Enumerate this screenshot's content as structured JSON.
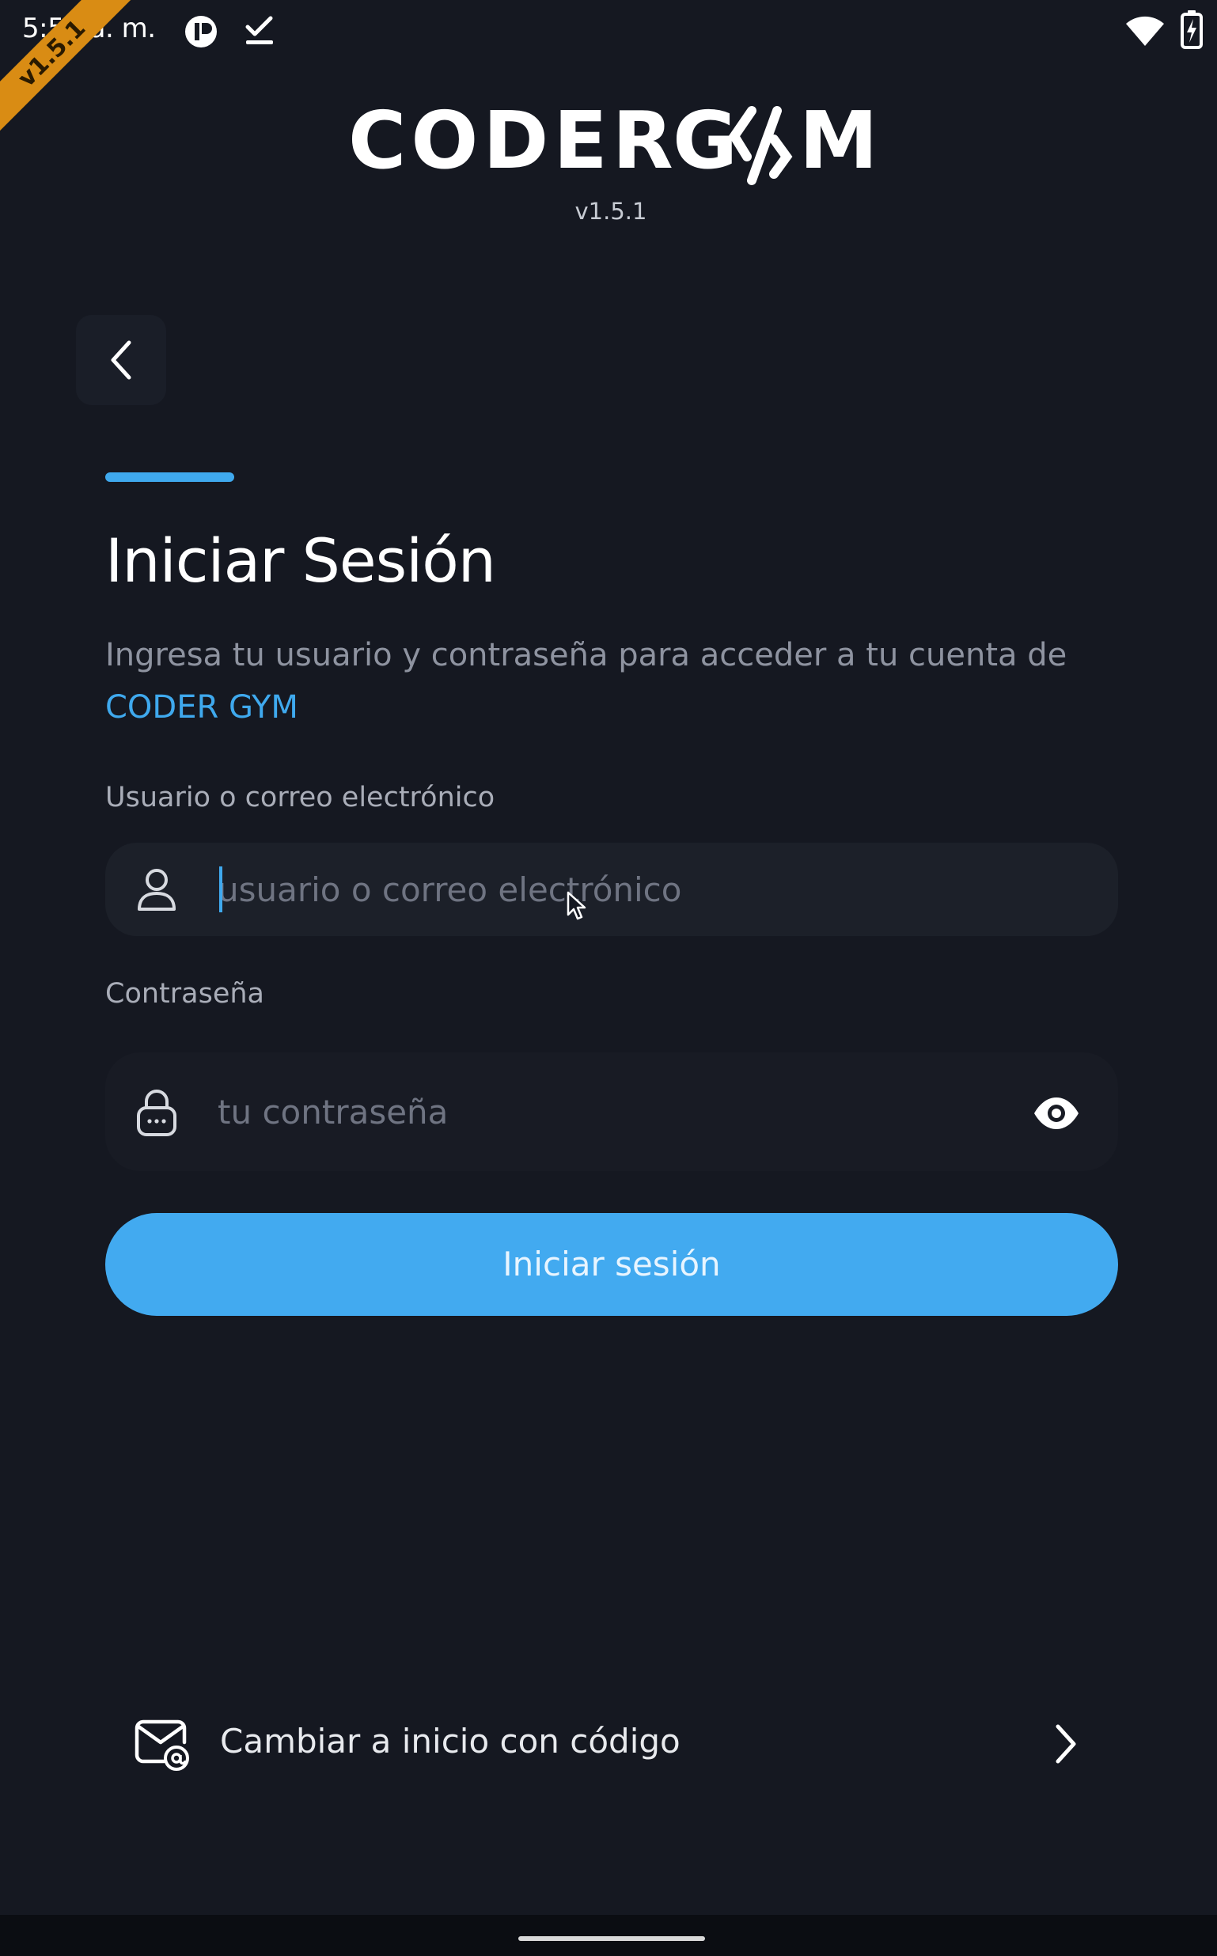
{
  "status_bar": {
    "time": "5:54 a. m.",
    "icons": [
      "app-notification-icon",
      "download-complete-icon",
      "wifi-icon",
      "battery-charging-icon"
    ]
  },
  "ribbon": {
    "text": "v1.5.1"
  },
  "header": {
    "logo_text": "CODER GYM",
    "version": "v1.5.1"
  },
  "login": {
    "title": "Iniciar Sesión",
    "subtitle_prefix": "Ingresa tu usuario y contraseña para acceder a tu cuenta de ",
    "subtitle_brand": "CODER GYM",
    "user_label": "Usuario o correo electrónico",
    "user_placeholder": "usuario o correo electrónico",
    "user_value": "",
    "password_label": "Contraseña",
    "password_placeholder": "tu contraseña",
    "password_value": "",
    "submit_label": "Iniciar sesión",
    "switch_label": "Cambiar a inicio con código"
  },
  "colors": {
    "background": "#151821",
    "accent": "#3fa9ee",
    "button": "#42aaf0",
    "input_background": "#1c2029",
    "ribbon": "#d98c14"
  }
}
